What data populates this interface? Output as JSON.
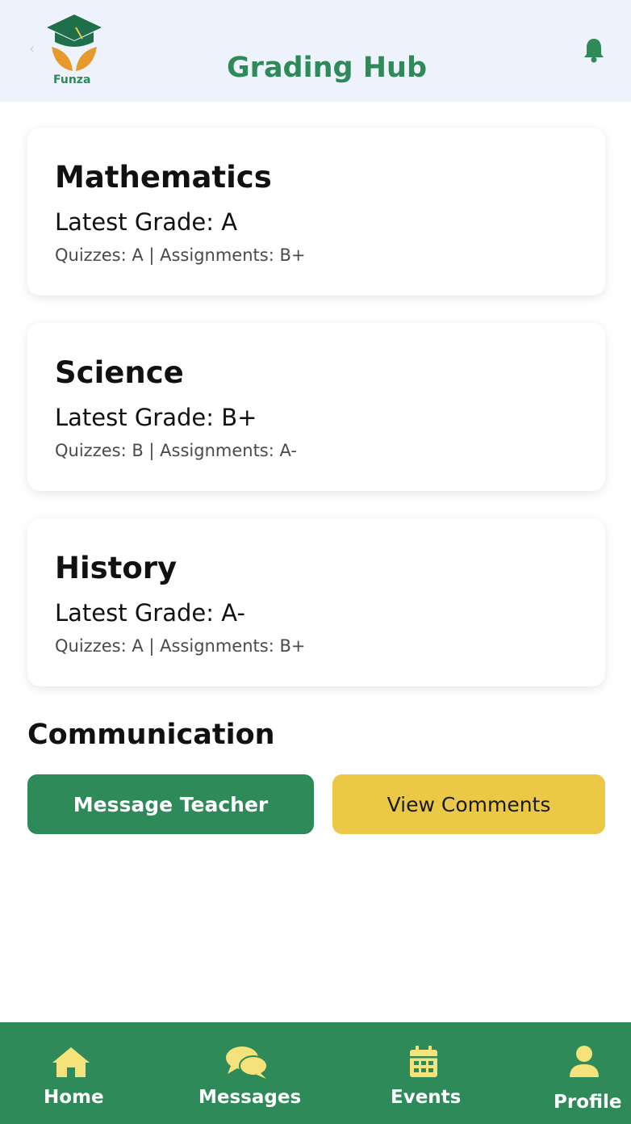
{
  "header": {
    "title": "Grading Hub",
    "logo_text": "Funza",
    "back_glyph": "‹"
  },
  "subjects": [
    {
      "name": "Mathematics",
      "latest_grade": "Latest Grade: A",
      "details": "Quizzes: A | Assignments: B+"
    },
    {
      "name": "Science",
      "latest_grade": "Latest Grade: B+",
      "details": "Quizzes: B | Assignments: A-"
    },
    {
      "name": "History",
      "latest_grade": "Latest Grade: A-",
      "details": "Quizzes: A | Assignments: B+"
    }
  ],
  "communication": {
    "title": "Communication",
    "message_teacher_label": "Message Teacher",
    "view_comments_label": "View Comments"
  },
  "nav": {
    "items": [
      {
        "label": "Home",
        "icon": "home-icon"
      },
      {
        "label": "Messages",
        "icon": "messages-icon"
      },
      {
        "label": "Events",
        "icon": "calendar-icon"
      },
      {
        "label": "Profile",
        "icon": "user-icon"
      }
    ]
  },
  "colors": {
    "primary_green": "#2e8a59",
    "accent_yellow": "#ecc847",
    "header_bg": "#eef2fd",
    "nav_icon_yellow": "#f5e27a"
  }
}
